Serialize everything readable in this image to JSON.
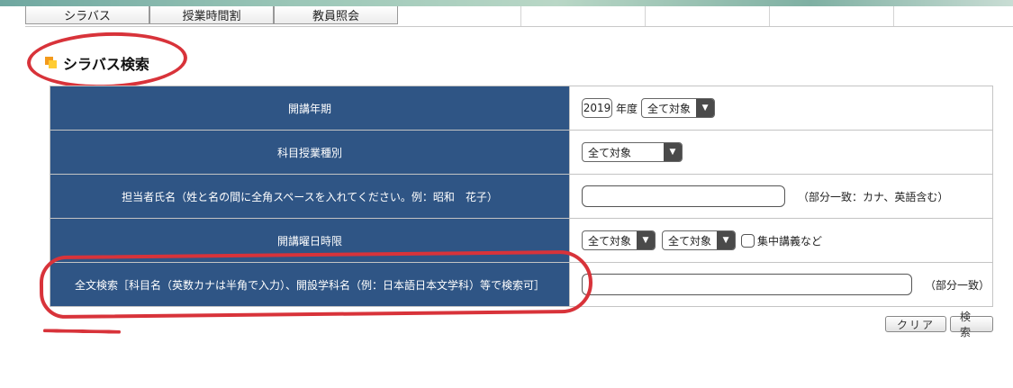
{
  "nav": {
    "tabs": [
      "シラバス",
      "授業時間割",
      "教員照会"
    ]
  },
  "page": {
    "title": "シラバス検索"
  },
  "form": {
    "rows": [
      {
        "label": "開講年期"
      },
      {
        "label": "科目授業種別"
      },
      {
        "label": "担当者氏名（姓と名の間に全角スペースを入れてください。例：昭和　花子）"
      },
      {
        "label": "開講曜日時限"
      },
      {
        "label": "全文検索［科目名（英数カナは半角で入力）、開設学科名（例：日本語日本文学科）等で検索可］"
      }
    ],
    "year_value": "2019",
    "year_suffix": "年度",
    "term_select": "全て対象",
    "subject_type_select": "全て対象",
    "teacher_name_value": "",
    "teacher_name_note": "（部分一致：カナ、英語含む）",
    "day_select": "全て対象",
    "period_select": "全て対象",
    "intensive_label": "集中講義など",
    "fulltext_value": "",
    "fulltext_note": "（部分一致）"
  },
  "buttons": {
    "clear": "クリア",
    "search": "検索"
  },
  "colors": {
    "header_cell": "#2f5585",
    "annotation": "#d8333a"
  }
}
